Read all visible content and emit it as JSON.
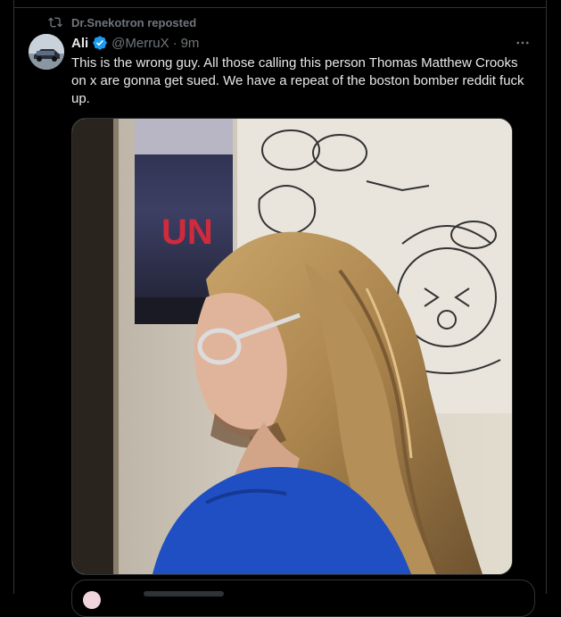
{
  "repost": {
    "icon": "repost-icon",
    "text": "Dr.Snekotron reposted"
  },
  "tweet": {
    "display_name": "Ali",
    "verified_icon": "verified-badge-icon",
    "handle": "@MerruX",
    "separator": "·",
    "time": "9m",
    "text": "This is the wrong guy. All those calling this person Thomas Matthew Crooks on x are gonna get sued. We have a repeat of the boston bomber reddit fuck up.",
    "more_icon": "more-options-icon",
    "media": {
      "poster_text": "UN"
    }
  },
  "colors": {
    "background": "#000000",
    "text_primary": "#e7e9ea",
    "text_secondary": "#71767b",
    "verified": "#1d9bf0",
    "border": "#2f3336"
  }
}
